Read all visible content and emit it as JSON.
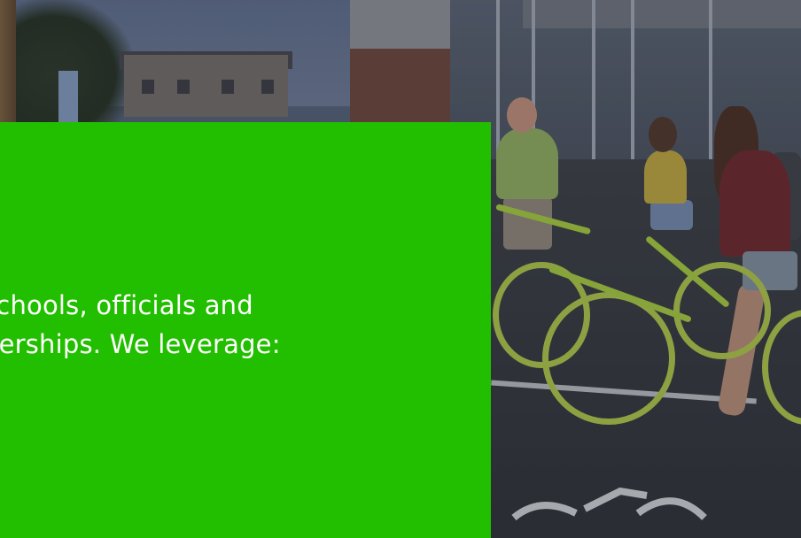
{
  "hero": {
    "photo_icon": "group-of-cyclists-photo",
    "description_text_lines": [
      "schools, officials and",
      "nerships. We leverage:"
    ]
  },
  "colors": {
    "panel_green": "#22bf00",
    "text_white": "#ffffff"
  }
}
